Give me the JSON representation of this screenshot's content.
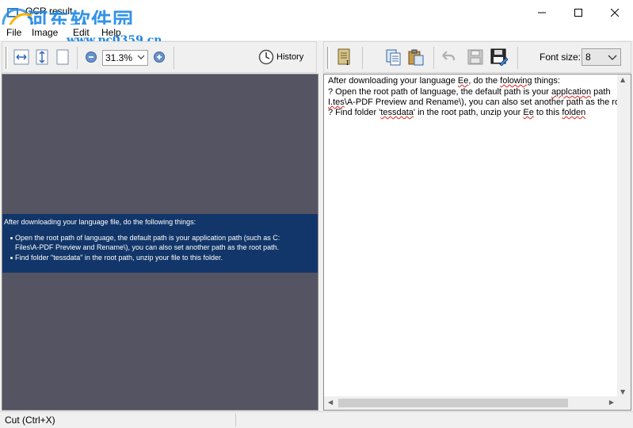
{
  "window": {
    "title": "OCR result",
    "watermark_text": "河东软件园",
    "watermark_url": "www.pc0359.cn"
  },
  "menu": [
    "File",
    "Image",
    "Edit",
    "Help"
  ],
  "image_toolbar": {
    "zoom_value": "31.3%",
    "history_label": "History"
  },
  "text_toolbar": {
    "font_size_label": "Font size:",
    "font_size_value": "8"
  },
  "image_preview": {
    "header": "After downloading your language file, do the following things:",
    "bullet1_line1": "Open the root path of language, the default path is your application path (such as C:",
    "bullet1_line2": "Files\\A-PDF Preview and Rename\\), you can also set another path as the root path.",
    "bullet2": "Find folder \"tessdata\" in the root path, unzip your file to this folder."
  },
  "ocr_text": {
    "line1": [
      "After downloading your language ",
      "Ee",
      ", do the ",
      "folowing",
      " things:"
    ],
    "line2": [
      "? Open the root path of language, the default path is your ",
      "applcation",
      " path"
    ],
    "line3": [
      "I.tes",
      "\\A-PDF Preview and Rename\\), you can also set another path as the ro"
    ],
    "line4": [
      "? Find folder '",
      "tessdata",
      "' in the root path, unzip your ",
      "Ee",
      " to this ",
      "folden"
    ]
  },
  "status": {
    "text": "Cut (Ctrl+X)"
  },
  "colors": {
    "image_background": "#555463",
    "document_strip": "#123669",
    "watermark": "#1e88e5",
    "spellcheck": "#e02020"
  }
}
